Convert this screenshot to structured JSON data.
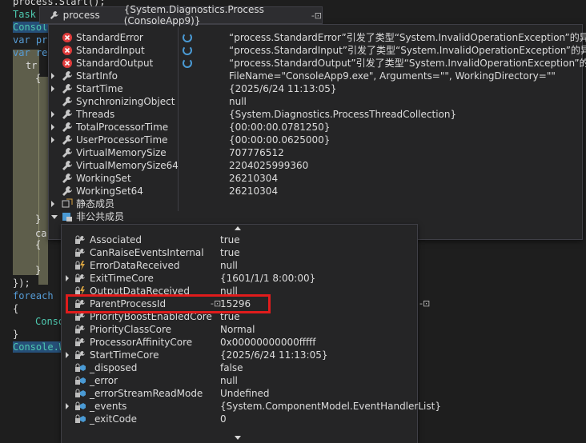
{
  "editor": {
    "lines": [
      {
        "text": "process.Start();"
      },
      {
        "text": "Task"
      },
      {
        "text": "Console"
      },
      {
        "text": "var pr"
      },
      {
        "text": "var re"
      },
      {
        "text": "tr"
      },
      {
        "text": "{"
      },
      {
        "text": "}"
      },
      {
        "text": "ca"
      },
      {
        "text": "{"
      },
      {
        "text": "}"
      },
      {
        "text": "});"
      },
      {
        "text": "foreach"
      },
      {
        "text": "{"
      },
      {
        "text": "Conso"
      },
      {
        "text": "}"
      },
      {
        "text": "Console.W"
      }
    ]
  },
  "datatip": {
    "header": {
      "name": "process",
      "value": "{System.Diagnostics.Process (ConsoleApp9)}",
      "pin": "-⊡"
    },
    "rows": [
      {
        "name": "StandardError",
        "value": "“process.StandardError”引发了类型“System.InvalidOperationException”的异常",
        "icon": "error-icon",
        "expandable": false,
        "refresh": true
      },
      {
        "name": "StandardInput",
        "value": "“process.StandardInput”引发了类型“System.InvalidOperationException”的异常",
        "icon": "error-icon",
        "expandable": false,
        "refresh": true
      },
      {
        "name": "StandardOutput",
        "value": "“process.StandardOutput”引发了类型“System.InvalidOperationException”的异常",
        "icon": "error-icon",
        "expandable": false,
        "refresh": true
      },
      {
        "name": "StartInfo",
        "value": "FileName=\"ConsoleApp9.exe\", Arguments=\"\", WorkingDirectory=\"\"",
        "icon": "wrench-icon",
        "expandable": true,
        "refresh": false
      },
      {
        "name": "StartTime",
        "value": "{2025/6/24 11:13:05}",
        "icon": "wrench-icon",
        "expandable": true,
        "refresh": false
      },
      {
        "name": "SynchronizingObject",
        "value": "null",
        "icon": "wrench-icon",
        "expandable": false,
        "refresh": false
      },
      {
        "name": "Threads",
        "value": "{System.Diagnostics.ProcessThreadCollection}",
        "icon": "wrench-icon",
        "expandable": true,
        "refresh": false
      },
      {
        "name": "TotalProcessorTime",
        "value": "{00:00:00.0781250}",
        "icon": "wrench-icon",
        "expandable": true,
        "refresh": false
      },
      {
        "name": "UserProcessorTime",
        "value": "{00:00:00.0625000}",
        "icon": "wrench-icon",
        "expandable": true,
        "refresh": false
      },
      {
        "name": "VirtualMemorySize",
        "value": "707776512",
        "icon": "wrench-icon",
        "expandable": false,
        "refresh": false
      },
      {
        "name": "VirtualMemorySize64",
        "value": "2204025999360",
        "icon": "wrench-icon",
        "expandable": false,
        "refresh": false
      },
      {
        "name": "WorkingSet",
        "value": "26210304",
        "icon": "wrench-icon",
        "expandable": false,
        "refresh": false
      },
      {
        "name": "WorkingSet64",
        "value": "26210304",
        "icon": "wrench-icon",
        "expandable": false,
        "refresh": false
      },
      {
        "name": "静态成员",
        "value": "",
        "icon": "static-members-icon",
        "expandable": true,
        "refresh": false
      },
      {
        "name": "非公共成员",
        "value": "",
        "icon": "nonpublic-members-icon",
        "expandable": true,
        "refresh": false,
        "expanded": true
      }
    ]
  },
  "subtip": {
    "rows": [
      {
        "name": "Associated",
        "value": "true",
        "icon": "private-property-icon",
        "expandable": false
      },
      {
        "name": "CanRaiseEventsInternal",
        "value": "true",
        "icon": "private-property-icon",
        "expandable": false
      },
      {
        "name": "ErrorDataReceived",
        "value": "null",
        "icon": "private-event-icon",
        "expandable": false
      },
      {
        "name": "ExitTimeCore",
        "value": "{1601/1/1 8:00:00}",
        "icon": "private-property-icon",
        "expandable": true
      },
      {
        "name": "OutputDataReceived",
        "value": "null",
        "icon": "private-event-icon",
        "expandable": false
      },
      {
        "name": "ParentProcessId",
        "value": "15296",
        "icon": "private-property-icon",
        "expandable": false,
        "highlighted": true
      },
      {
        "name": "PriorityBoostEnabledCore",
        "value": "true",
        "icon": "private-property-icon",
        "expandable": false
      },
      {
        "name": "PriorityClassCore",
        "value": "Normal",
        "icon": "private-property-icon",
        "expandable": false
      },
      {
        "name": "ProcessorAffinityCore",
        "value": "0x00000000000fffff",
        "icon": "private-property-icon",
        "expandable": false
      },
      {
        "name": "StartTimeCore",
        "value": "{2025/6/24 11:13:05}",
        "icon": "private-property-icon",
        "expandable": true
      },
      {
        "name": "_disposed",
        "value": "false",
        "icon": "private-field-icon",
        "expandable": false
      },
      {
        "name": "_error",
        "value": "null",
        "icon": "private-field-icon",
        "expandable": false
      },
      {
        "name": "_errorStreamReadMode",
        "value": "Undefined",
        "icon": "private-field-icon",
        "expandable": false
      },
      {
        "name": "_events",
        "value": "{System.ComponentModel.EventHandlerList}",
        "icon": "private-field-icon",
        "expandable": true
      },
      {
        "name": "_exitCode",
        "value": "0",
        "icon": "private-field-icon",
        "expandable": false
      }
    ],
    "pin": "-⊡"
  },
  "colors": {
    "highlight_box": "#e01c1c",
    "error": "#e03c3c",
    "refresh": "#4a9ad4"
  }
}
